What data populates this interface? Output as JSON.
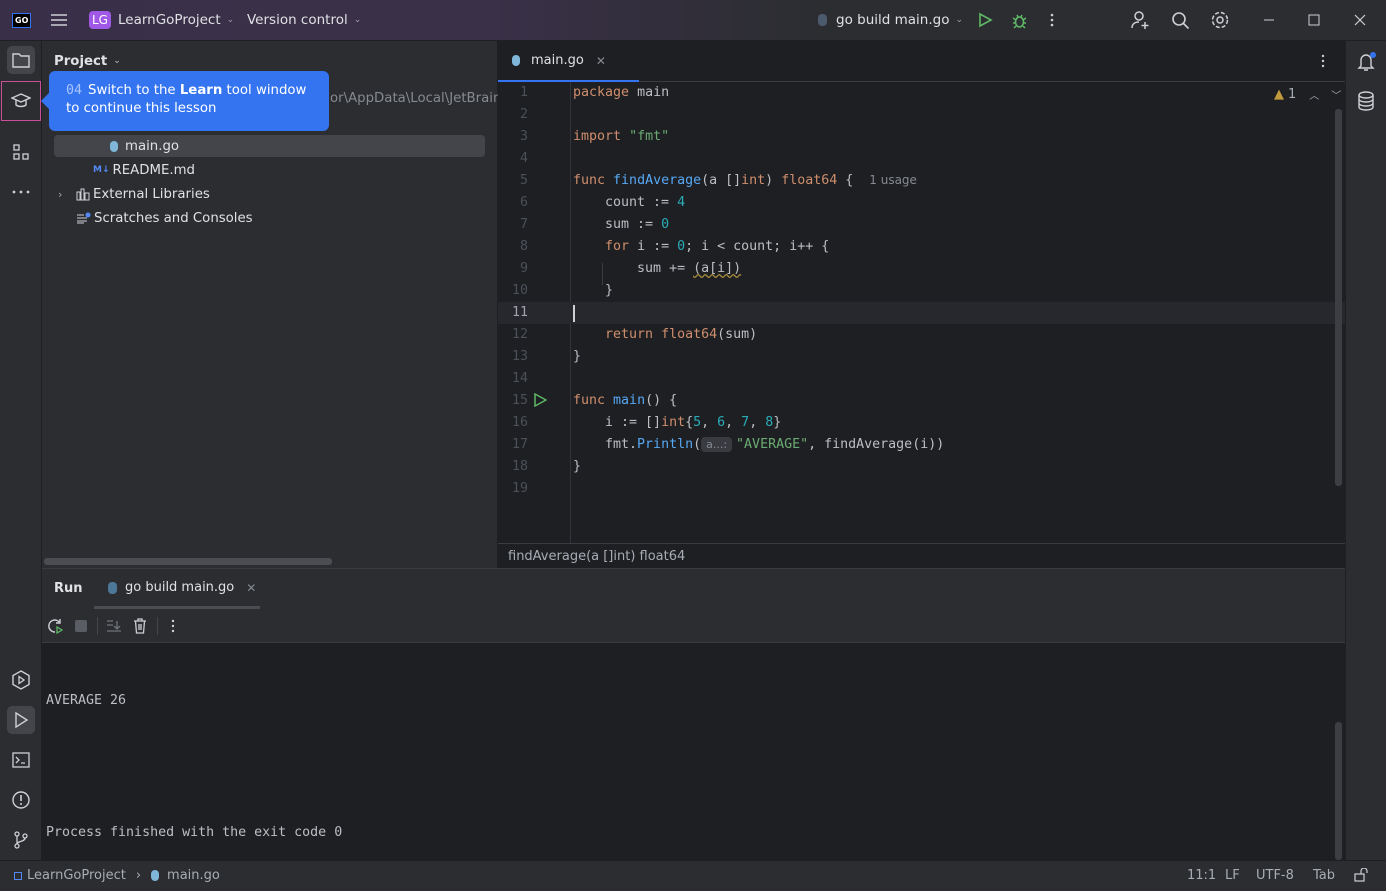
{
  "titlebar": {
    "app_logo": "GO",
    "project_badge": "LG",
    "project_name": "LearnGoProject",
    "vcs": "Version control",
    "run_config": "go build main.go",
    "icons": [
      "hamburger-menu-icon",
      "run-icon",
      "debug-icon",
      "more-icon",
      "add-user-icon",
      "search-icon",
      "settings-icon",
      "minimize-icon",
      "maximize-icon",
      "close-icon"
    ]
  },
  "project_panel": {
    "title": "Project",
    "path_fragment": "or\\AppData\\Local\\JetBrains",
    "items": [
      {
        "label": "main.go",
        "icon": "gopher-file-icon",
        "selected": true
      },
      {
        "label": "README.md",
        "icon": "markdown-icon"
      },
      {
        "label": "External Libraries",
        "icon": "library-icon"
      },
      {
        "label": "Scratches and Consoles",
        "icon": "scratches-icon"
      }
    ]
  },
  "tooltip": {
    "step": "04",
    "text_before": "Switch to the ",
    "bold": "Learn",
    "text_after": " tool window to continue this lesson"
  },
  "editor": {
    "tab": "main.go",
    "warnings": "1",
    "current_line": 11,
    "breadcrumb": "findAverage(a []int) float64",
    "lines": [
      [
        [
          "package",
          "kw"
        ],
        " ",
        [
          "main",
          ""
        ]
      ],
      [],
      [
        [
          "import",
          "kw"
        ],
        " ",
        [
          "\"fmt\"",
          "str"
        ]
      ],
      [],
      [
        [
          "func",
          "kw"
        ],
        " ",
        [
          "findAverage",
          "fn"
        ],
        "(a []",
        [
          "int",
          "kw"
        ],
        ") ",
        [
          "float64",
          "kw"
        ],
        " {  ",
        [
          "1 usage",
          "hint"
        ]
      ],
      [
        "    count := ",
        [
          "4",
          "num"
        ]
      ],
      [
        "    sum := ",
        [
          "0",
          "num"
        ]
      ],
      [
        "    ",
        [
          "for",
          "kw"
        ],
        " i := ",
        [
          "0",
          "num"
        ],
        "; i < count; i++ {"
      ],
      [
        "        sum += ",
        [
          "(a[i])",
          "warnu"
        ]
      ],
      [
        "    }"
      ],
      [],
      [
        "    ",
        [
          "return",
          "kw"
        ],
        " ",
        [
          "float64",
          "kw"
        ],
        "(sum)"
      ],
      [
        "}"
      ],
      [],
      [
        [
          "func",
          "kw"
        ],
        " ",
        [
          "main",
          "fn"
        ],
        "() {"
      ],
      [
        "    i := []",
        [
          "int",
          "kw"
        ],
        "{",
        [
          "5",
          "num"
        ],
        ", ",
        [
          "6",
          "num"
        ],
        ", ",
        [
          "7",
          "num"
        ],
        ", ",
        [
          "8",
          "num"
        ],
        "}"
      ],
      [
        "    fmt.",
        [
          "Println",
          "fn2"
        ],
        "(",
        [
          "a...:",
          "inl"
        ],
        [
          "\"AVERAGE\"",
          "str"
        ],
        ", ",
        [
          "findAverage",
          "fn2"
        ],
        "(i))"
      ],
      [
        "}"
      ],
      []
    ]
  },
  "run_panel": {
    "title": "Run",
    "tab": "go build main.go",
    "output": [
      "AVERAGE 26",
      "",
      "Process finished with the exit code 0"
    ]
  },
  "status_bar": {
    "project": "LearnGoProject",
    "file": "main.go",
    "position": "11:1",
    "line_ending": "LF",
    "encoding": "UTF-8",
    "indent": "Tab"
  },
  "colors": {
    "accent": "#3574f0",
    "keyword": "#cf8e6d",
    "function": "#56a8f5",
    "number": "#2aacb8",
    "string": "#6aab73",
    "run_green": "#5fb865"
  }
}
